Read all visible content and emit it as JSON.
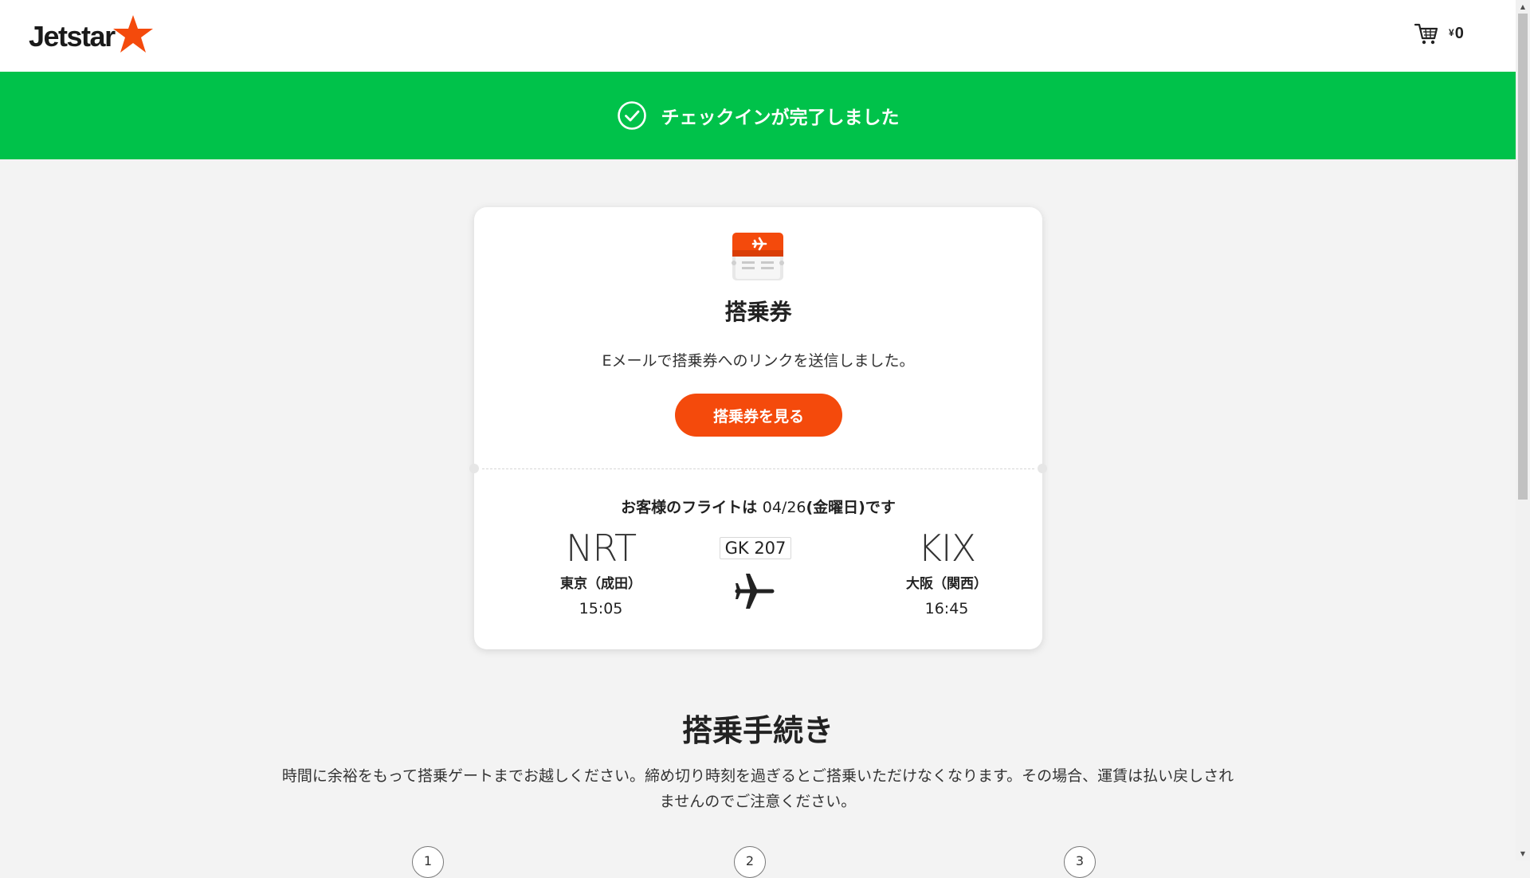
{
  "header": {
    "logo_text": "Jetstar",
    "cart_currency": "¥",
    "cart_amount": "0"
  },
  "banner": {
    "message": "チェックインが完了しました"
  },
  "card": {
    "title": "搭乗券",
    "message": "Eメールで搭乗券へのリンクを送信しました。",
    "button_label": "搭乗券を見る",
    "flight_prefix": "お客様のフライトは",
    "flight_date": "04/26",
    "flight_day": "(金曜日)",
    "flight_suffix": "です",
    "flight_number": "GK 207",
    "origin": {
      "code": "NRT",
      "city": "東京（成田）",
      "time": "15:05"
    },
    "destination": {
      "code": "KIX",
      "city": "大阪（関西）",
      "time": "16:45"
    }
  },
  "procedures": {
    "title": "搭乗手続き",
    "description": "時間に余裕をもって搭乗ゲートまでお越しください。締め切り時刻を過ぎるとご搭乗いただけなくなります。その場合、運賃は払い戻しされませんのでご注意ください。",
    "steps": [
      "1",
      "2",
      "3"
    ]
  },
  "colors": {
    "brand_orange": "#f44a0c",
    "success_green": "#00c24a"
  }
}
